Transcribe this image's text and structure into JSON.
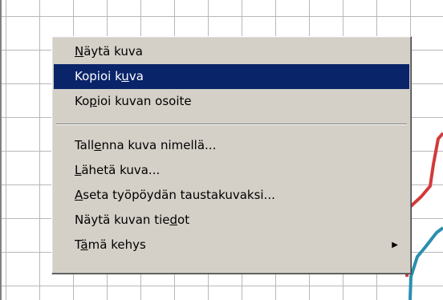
{
  "context_menu": {
    "items": [
      {
        "label": "Näytä kuva",
        "access_key_index": 0,
        "highlighted": false
      },
      {
        "label": "Kopioi kuva",
        "access_key_index": 8,
        "highlighted": true
      },
      {
        "label": "Kopioi kuvan osoite",
        "access_key_index": 2,
        "highlighted": false
      },
      {
        "label": "Tallenna kuva nimellä...",
        "access_key_index": 4,
        "highlighted": false
      },
      {
        "label": "Lähetä kuva...",
        "access_key_index": 0,
        "highlighted": false
      },
      {
        "label": "Aseta työpöydän taustakuvaksi...",
        "access_key_index": 0,
        "highlighted": false
      },
      {
        "label": "Näytä kuvan tiedot",
        "access_key_index": 15,
        "highlighted": false
      },
      {
        "label": "Tämä kehys",
        "access_key_index": 1,
        "highlighted": false
      }
    ],
    "submenu_arrow": "▶"
  },
  "colors": {
    "menu_background": "#d4d0c8",
    "highlight": "#0a246a",
    "highlight_text": "#ffffff",
    "grid_line": "#b8b8b8",
    "red_line": "#d23a3a",
    "teal_line": "#2a8fb0"
  }
}
